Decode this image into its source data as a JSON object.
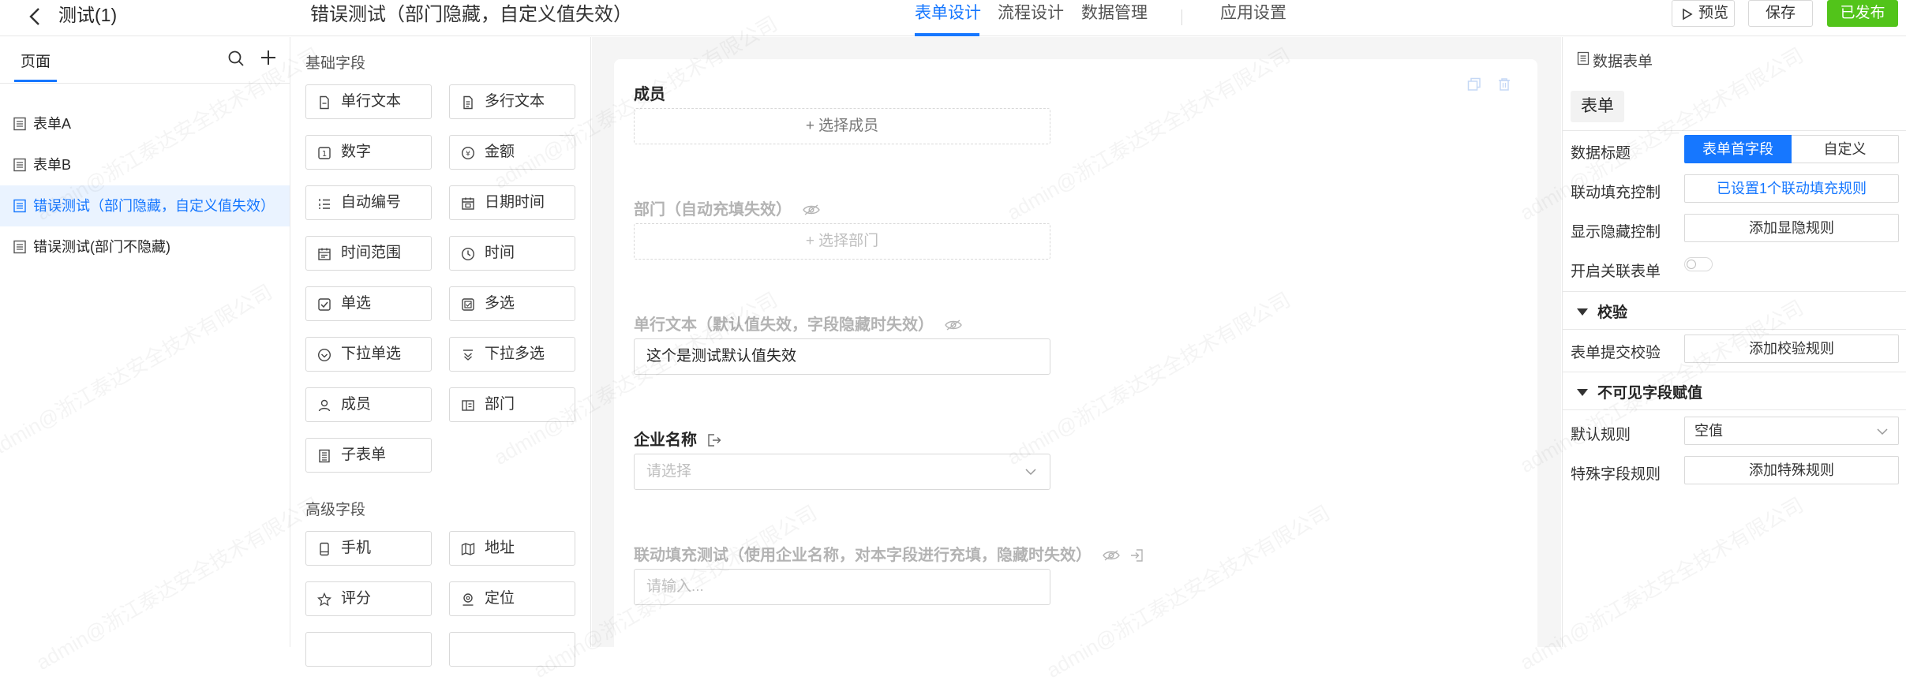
{
  "topbar": {
    "app_title": "测试(1)",
    "form_title": "错误测试（部门隐藏，自定义值失效）",
    "tabs": [
      {
        "label": "表单设计",
        "active": true
      },
      {
        "label": "流程设计",
        "active": false
      },
      {
        "label": "数据管理",
        "active": false
      },
      {
        "label": "应用设置",
        "active": false
      }
    ],
    "preview_label": "预览",
    "save_label": "保存",
    "publish_label": "已发布"
  },
  "sidebar": {
    "tab_label": "页面",
    "items": [
      {
        "label": "表单A",
        "active": false
      },
      {
        "label": "表单B",
        "active": false
      },
      {
        "label": "错误测试（部门隐藏，自定义值失效）",
        "active": true
      },
      {
        "label": "错误测试(部门不隐藏)",
        "active": false
      }
    ]
  },
  "palette": {
    "basic_title": "基础字段",
    "basic_fields": [
      {
        "label": "单行文本",
        "icon": "single-line-text-icon"
      },
      {
        "label": "多行文本",
        "icon": "multi-line-text-icon"
      },
      {
        "label": "数字",
        "icon": "number-icon"
      },
      {
        "label": "金额",
        "icon": "currency-icon"
      },
      {
        "label": "自动编号",
        "icon": "auto-number-icon"
      },
      {
        "label": "日期时间",
        "icon": "datetime-icon"
      },
      {
        "label": "时间范围",
        "icon": "time-range-icon"
      },
      {
        "label": "时间",
        "icon": "clock-icon"
      },
      {
        "label": "单选",
        "icon": "radio-icon"
      },
      {
        "label": "多选",
        "icon": "checkbox-icon"
      },
      {
        "label": "下拉单选",
        "icon": "dropdown-single-icon"
      },
      {
        "label": "下拉多选",
        "icon": "dropdown-multi-icon"
      },
      {
        "label": "成员",
        "icon": "member-icon"
      },
      {
        "label": "部门",
        "icon": "department-icon"
      },
      {
        "label": "子表单",
        "icon": "subform-icon"
      }
    ],
    "advanced_title": "高级字段",
    "advanced_fields": [
      {
        "label": "手机",
        "icon": "phone-icon"
      },
      {
        "label": "地址",
        "icon": "map-icon"
      },
      {
        "label": "评分",
        "icon": "star-icon"
      },
      {
        "label": "定位",
        "icon": "location-icon"
      }
    ]
  },
  "canvas": {
    "fields": [
      {
        "label": "成员",
        "placeholder": "+ 选择成员",
        "hidden": false
      },
      {
        "label": "部门（自动充填失效）",
        "placeholder": "+ 选择部门",
        "hidden": true
      },
      {
        "label": "单行文本（默认值失效，字段隐藏时失效）",
        "value": "这个是测试默认值失效",
        "hidden": true
      },
      {
        "label": "企业名称",
        "placeholder": "请选择",
        "hidden": false
      },
      {
        "label": "联动填充测试（使用企业名称，对本字段进行充填，隐藏时失效）",
        "placeholder": "请输入...",
        "hidden": true
      }
    ]
  },
  "panel": {
    "header": "数据表单",
    "tab_label": "表单",
    "data_title_label": "数据标题",
    "data_title_options": [
      "表单首字段",
      "自定义"
    ],
    "linkage_label": "联动填充控制",
    "linkage_value": "已设置1个联动填充规则",
    "visibility_label": "显示隐藏控制",
    "visibility_button": "添加显隐规则",
    "related_form_label": "开启关联表单",
    "validation_section": "校验",
    "submit_validation_label": "表单提交校验",
    "submit_validation_button": "添加校验规则",
    "invisible_section": "不可见字段赋值",
    "default_rule_label": "默认规则",
    "default_rule_value": "空值",
    "special_rule_label": "特殊字段规则",
    "special_rule_button": "添加特殊规则"
  },
  "watermark": "admin@浙江泰达安全技术有限公司",
  "colors": {
    "accent": "#1677ff",
    "publish": "#52c41a"
  }
}
